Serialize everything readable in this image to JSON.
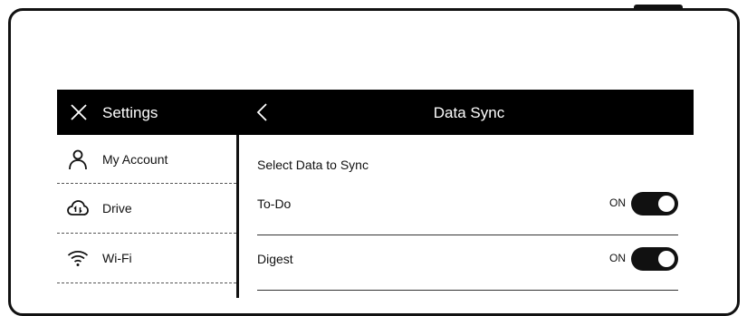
{
  "header": {
    "settings_title": "Settings",
    "page_title": "Data Sync"
  },
  "sidebar": {
    "items": [
      {
        "label": "My Account",
        "icon": "person-icon"
      },
      {
        "label": "Drive",
        "icon": "cloud-sync-icon"
      },
      {
        "label": "Wi-Fi",
        "icon": "wifi-icon"
      }
    ]
  },
  "content": {
    "section_title": "Select Data to Sync",
    "rows": [
      {
        "label": "To-Do",
        "state": "ON",
        "enabled": true
      },
      {
        "label": "Digest",
        "state": "ON",
        "enabled": true
      }
    ]
  },
  "colors": {
    "header_bg": "#000000",
    "toggle_on": "#111111",
    "background": "#ffffff"
  }
}
